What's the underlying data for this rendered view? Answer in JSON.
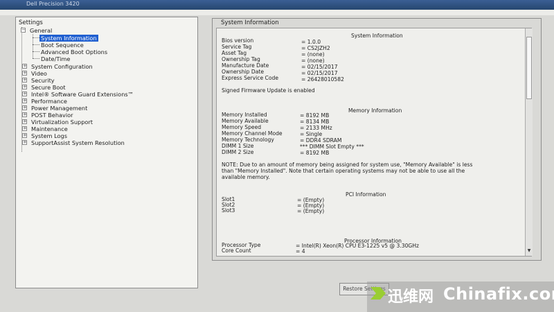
{
  "window": {
    "title": "Dell Precision 3420"
  },
  "left": {
    "header": "Settings",
    "general": "General",
    "general_children": [
      "System Information",
      "Boot Sequence",
      "Advanced Boot Options",
      "Date/Time"
    ],
    "items": [
      "System Configuration",
      "Video",
      "Security",
      "Secure Boot",
      "Intel® Software Guard Extensions™",
      "Performance",
      "Power Management",
      "POST Behavior",
      "Virtualization Support",
      "Maintenance",
      "System Logs",
      "SupportAssist System Resolution"
    ]
  },
  "right": {
    "group_title": "System Information",
    "system_heading": "System Information",
    "system_rows": [
      {
        "label": "Bios version",
        "value": "= 1.0.0"
      },
      {
        "label": "Service Tag",
        "value": "= CS2JZH2"
      },
      {
        "label": "Asset Tag",
        "value": "= (none)"
      },
      {
        "label": "Ownership Tag",
        "value": "= (none)"
      },
      {
        "label": "Manufacture Date",
        "value": "= 02/15/2017"
      },
      {
        "label": "Ownership Date",
        "value": "= 02/15/2017"
      },
      {
        "label": "Express Service Code",
        "value": "= 26428010582"
      }
    ],
    "signed_fw": "Signed Firmware Update is enabled",
    "memory_heading": "Memory Information",
    "memory_rows": [
      {
        "label": "Memory Installed",
        "value": "= 8192 MB"
      },
      {
        "label": "Memory Available",
        "value": "= 8134 MB"
      },
      {
        "label": "Memory Speed",
        "value": "= 2133 MHz"
      },
      {
        "label": "Memory Channel Mode",
        "value": "= Single"
      },
      {
        "label": "Memory Technology",
        "value": "= DDR4 SDRAM"
      },
      {
        "label": "DIMM 1 Size",
        "value": "*** DIMM Slot Empty ***"
      },
      {
        "label": "DIMM 2 Size",
        "value": "= 8192 MB"
      }
    ],
    "note_lines": [
      "NOTE: Due to an amount of memory being assigned for system use, \"Memory Available\" is less",
      "than \"Memory Installed\". Note that certain operating systems may not be able to use all the",
      "available memory."
    ],
    "pci_heading": "PCI Information",
    "pci_rows": [
      {
        "label": "Slot1",
        "value": "= (Empty)"
      },
      {
        "label": "Slot2",
        "value": "= (Empty)"
      },
      {
        "label": "Slot3",
        "value": "= (Empty)"
      }
    ],
    "proc_heading": "Processor Information",
    "proc_rows": [
      {
        "label": "Processor Type",
        "value": "= Intel(R) Xeon(R) CPU E3-1225 v5 @ 3.30GHz"
      },
      {
        "label": "Core Count",
        "value": "= 4"
      }
    ]
  },
  "footer": {
    "restore_label": "Restore Settings"
  },
  "watermark": {
    "cn": "迅维网",
    "en": "Chinafix.com"
  }
}
